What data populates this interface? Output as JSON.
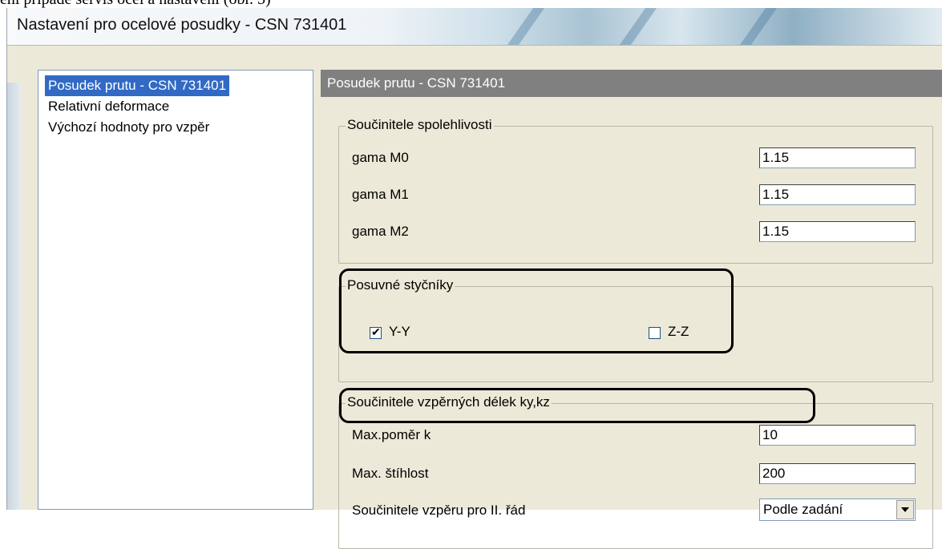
{
  "document_caption": "ení případě servis ocel a nastavení (obr. 5)",
  "window": {
    "title": "Nastavení pro ocelové posudky - CSN 731401"
  },
  "tree": {
    "items": [
      {
        "label": "Posudek prutu - CSN 731401",
        "selected": true
      },
      {
        "label": "Relativní deformace",
        "selected": false
      },
      {
        "label": "Výchozí hodnoty pro vzpěr",
        "selected": false
      }
    ]
  },
  "panel": {
    "header": "Posudek prutu - CSN 731401"
  },
  "groups": {
    "reliability": {
      "title": "Součinitele spolehlivosti",
      "fields": [
        {
          "label": "gama M0",
          "value": "1.15"
        },
        {
          "label": "gama M1",
          "value": "1.15"
        },
        {
          "label": "gama M2",
          "value": "1.15"
        }
      ]
    },
    "sliding_joints": {
      "title": "Posuvné styčníky",
      "checkboxes": [
        {
          "label": "Y-Y",
          "checked": true
        },
        {
          "label": "Z-Z",
          "checked": false
        }
      ]
    },
    "buckling": {
      "title": "Součinitele vzpěrných délek ky,kz",
      "fields": [
        {
          "label": "Max.poměr k",
          "value": "10"
        },
        {
          "label": "Max. štíhlost",
          "value": "200"
        }
      ],
      "select": {
        "label": "Součinitele vzpěru pro II. řád",
        "value": "Podle zadání"
      }
    }
  },
  "icons": {
    "checkmark": "check-icon",
    "dropdown": "chevron-down-icon"
  },
  "colors": {
    "selection": "#316ac5",
    "panel_header": "#808080",
    "face": "#ece9d8"
  }
}
